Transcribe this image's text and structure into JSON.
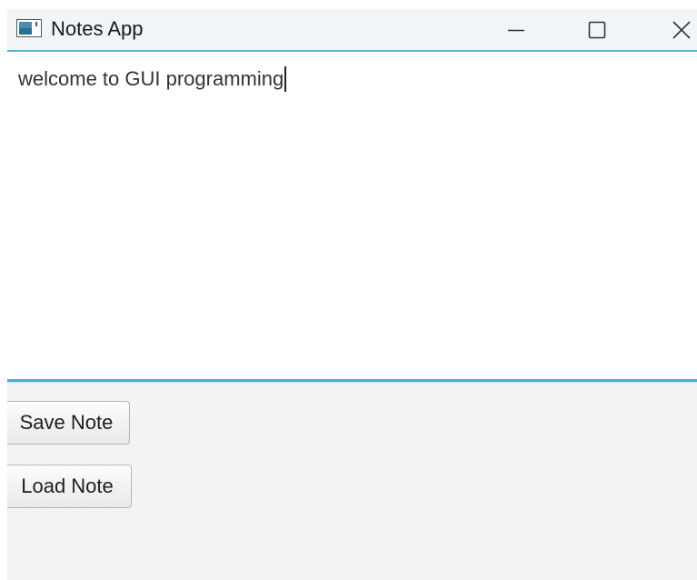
{
  "window": {
    "title": "Notes App",
    "controls": {
      "minimize": "minimize-icon",
      "maximize": "maximize-icon",
      "close": "close-icon"
    }
  },
  "editor": {
    "value": "welcome to GUI programming"
  },
  "actions": {
    "save_label": "Save Note",
    "load_label": "Load Note"
  },
  "colors": {
    "accent": "#4aaedf",
    "background": "#f3f3f3"
  }
}
